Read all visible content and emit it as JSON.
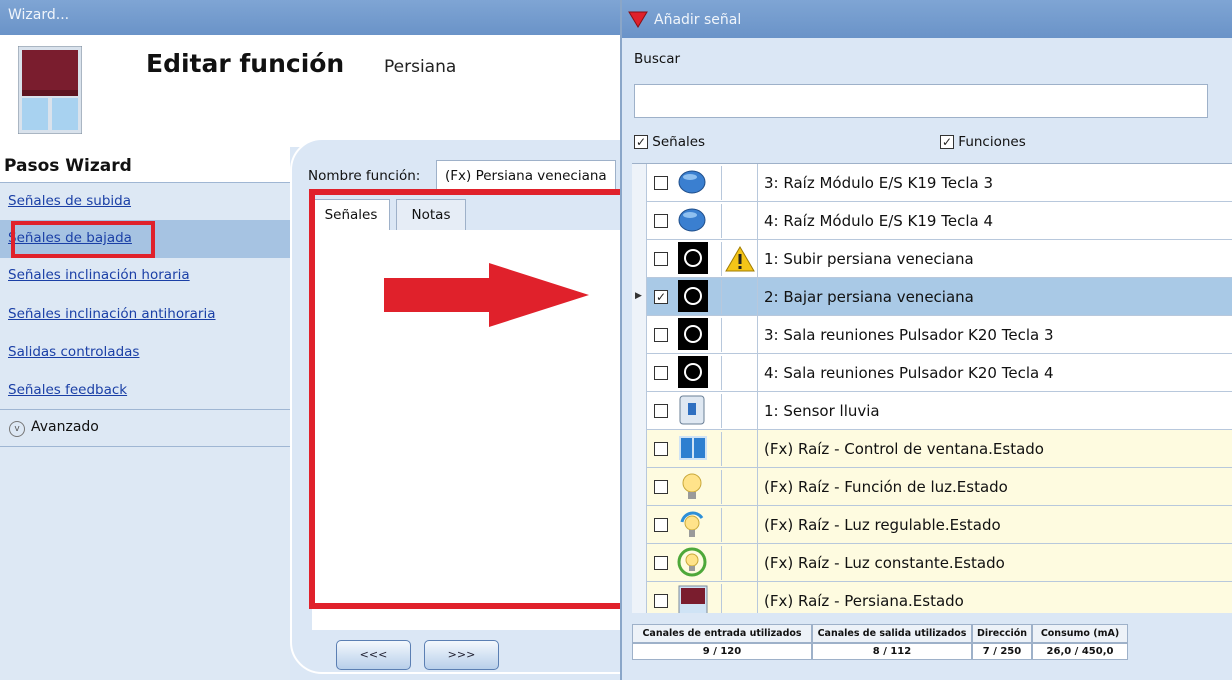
{
  "left": {
    "window_title": "Wizard...",
    "header_title": "Editar función",
    "header_subtitle": "Persiana",
    "steps_title": "Pasos Wizard",
    "steps": [
      {
        "label": "Señales de subida",
        "selected": false
      },
      {
        "label": "Señales de bajada",
        "selected": true
      },
      {
        "label": "Señales inclinación horaria",
        "selected": false
      },
      {
        "label": "Señales inclinación antihoraria",
        "selected": false
      },
      {
        "label": "Salidas controladas",
        "selected": false
      },
      {
        "label": "Señales feedback",
        "selected": false
      }
    ],
    "advanced_label": "Avanzado",
    "nombre_funcion_label": "Nombre función:",
    "nombre_funcion_value": "(Fx) Persiana veneciana",
    "tabs": [
      "Señales",
      "Notas"
    ],
    "prev_label": "<<<",
    "next_label": ">>>"
  },
  "right": {
    "window_title": "Añadir señal",
    "buscar_label": "Buscar",
    "search_value": "",
    "filter_senales": {
      "label": "Señales",
      "checked": true
    },
    "filter_funciones": {
      "label": "Funciones",
      "checked": true
    },
    "rows": [
      {
        "name": "3: Raíz Módulo E/S K19 Tecla 3",
        "icon": "blue-button-icon",
        "checked": false,
        "warning": false,
        "fx": false,
        "selected": false
      },
      {
        "name": "4: Raíz Módulo E/S K19 Tecla 4",
        "icon": "blue-button-icon",
        "checked": false,
        "warning": false,
        "fx": false,
        "selected": false
      },
      {
        "name": "1: Subir persiana veneciana",
        "icon": "push-button-icon",
        "checked": false,
        "warning": true,
        "fx": false,
        "selected": false
      },
      {
        "name": "2: Bajar persiana veneciana",
        "icon": "push-button-icon",
        "checked": true,
        "warning": false,
        "fx": false,
        "selected": true
      },
      {
        "name": "3: Sala reuniones Pulsador K20 Tecla 3",
        "icon": "push-button-icon",
        "checked": false,
        "warning": false,
        "fx": false,
        "selected": false
      },
      {
        "name": "4: Sala reuniones Pulsador K20 Tecla 4",
        "icon": "push-button-icon",
        "checked": false,
        "warning": false,
        "fx": false,
        "selected": false
      },
      {
        "name": "1: Sensor lluvia",
        "icon": "rain-sensor-icon",
        "checked": false,
        "warning": false,
        "fx": false,
        "selected": false
      },
      {
        "name": "(Fx) Raíz - Control de ventana.Estado",
        "icon": "window-icon",
        "checked": false,
        "warning": false,
        "fx": true,
        "selected": false
      },
      {
        "name": "(Fx) Raíz - Función de luz.Estado",
        "icon": "bulb-icon",
        "checked": false,
        "warning": false,
        "fx": true,
        "selected": false
      },
      {
        "name": "(Fx) Raíz - Luz regulable.Estado",
        "icon": "dimmable-bulb-icon",
        "checked": false,
        "warning": false,
        "fx": true,
        "selected": false
      },
      {
        "name": "(Fx) Raíz - Luz constante.Estado",
        "icon": "constant-light-icon",
        "checked": false,
        "warning": false,
        "fx": true,
        "selected": false
      },
      {
        "name": "(Fx) Raíz - Persiana.Estado",
        "icon": "blind-icon",
        "checked": false,
        "warning": false,
        "fx": true,
        "selected": false
      }
    ],
    "footer": {
      "headers": [
        "Canales de entrada utilizados",
        "Canales de salida utilizados",
        "Dirección",
        "Consumo (mA)"
      ],
      "values": [
        "9 / 120",
        "8 / 112",
        "7 / 250",
        "26,0 / 450,0"
      ]
    }
  },
  "colors": {
    "highlight": "#e0212b",
    "accent": "#6a93c8",
    "selected_row": "#a9c9e6"
  }
}
